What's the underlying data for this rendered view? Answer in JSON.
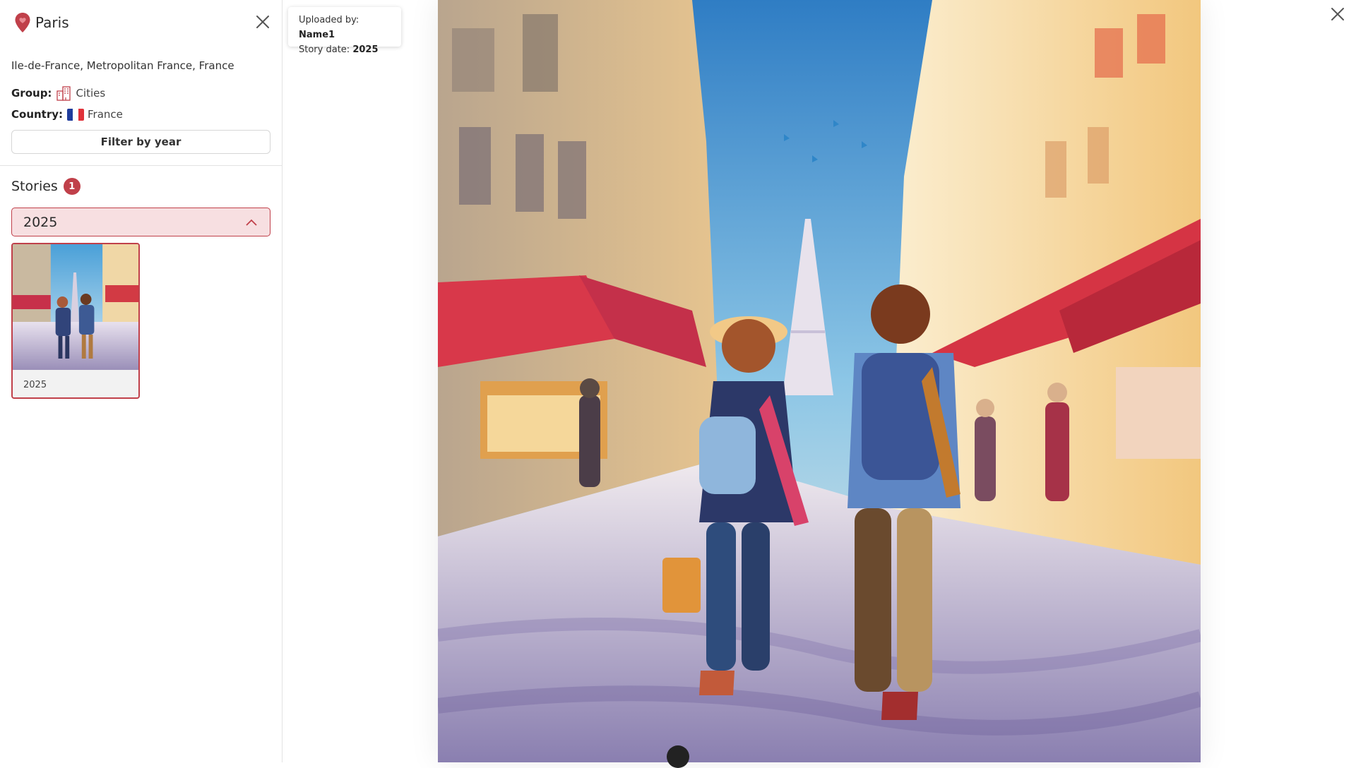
{
  "sidebar": {
    "title": "Paris",
    "location": "Ile-de-France, Metropolitan France, France",
    "group_label": "Group:",
    "group_value": "Cities",
    "country_label": "Country:",
    "country_value": "France",
    "filter_button": "Filter by year",
    "stories_title": "Stories",
    "stories_count": "1",
    "year_selected": "2025",
    "story_cards": [
      {
        "caption": "2025"
      }
    ]
  },
  "viewer": {
    "uploaded_label": "Uploaded by:",
    "uploaded_value": "Name1",
    "date_label": "Story date:",
    "date_value": "2025"
  },
  "colors": {
    "accent": "#c0404a",
    "accent_light": "#f7dfe1"
  },
  "icons": [
    "map-pin-icon",
    "close-icon",
    "city-building-icon",
    "france-flag-icon",
    "chevron-up-icon"
  ]
}
